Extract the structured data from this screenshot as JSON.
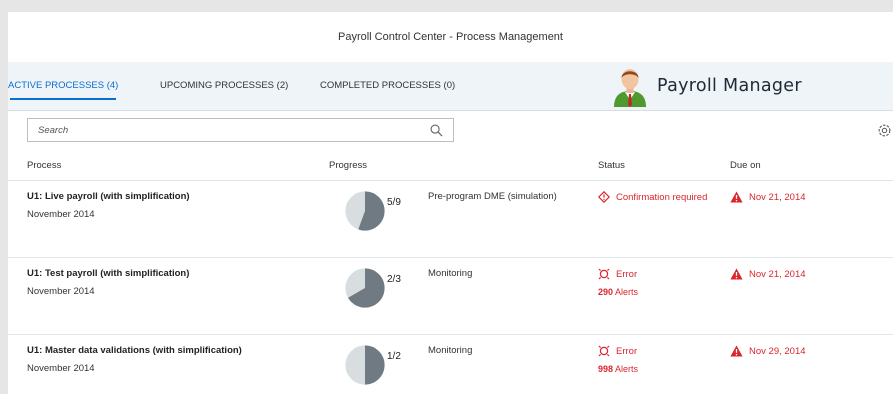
{
  "header": {
    "title": "Payroll Control Center - Process Management"
  },
  "tabs": [
    {
      "label": "ACTIVE PROCESSES (4)"
    },
    {
      "label": "UPCOMING PROCESSES (2)"
    },
    {
      "label": "COMPLETED PROCESSES (0)"
    }
  ],
  "user": {
    "name": "Payroll Manager",
    "icon": "user-avatar-icon"
  },
  "search": {
    "placeholder": "Search"
  },
  "columns": {
    "process": "Process",
    "progress": "Progress",
    "status": "Status",
    "due": "Due on"
  },
  "colors": {
    "accent": "#0a6ed1",
    "error": "#d9262c",
    "pie_fill": "#6f7a83",
    "pie_bg": "#d8dde0"
  },
  "rows": [
    {
      "name": "U1: Live payroll (with simplification)",
      "period": "November 2014",
      "progress": "5/9",
      "progress_fraction": 0.5556,
      "step": "Pre-program DME (simulation)",
      "status": "Confirmation required",
      "status_icon": "warning-diamond-icon",
      "alerts_count": "",
      "alerts_label": "",
      "due": "Nov 21, 2014"
    },
    {
      "name": "U1: Test payroll (with simplification)",
      "period": "November 2014",
      "progress": "2/3",
      "progress_fraction": 0.6667,
      "step": "Monitoring",
      "status": "Error",
      "status_icon": "error-icon",
      "alerts_count": "290",
      "alerts_label": "Alerts",
      "due": "Nov 21, 2014"
    },
    {
      "name": "U1: Master data validations (with simplification)",
      "period": "November 2014",
      "progress": "1/2",
      "progress_fraction": 0.5,
      "step": "Monitoring",
      "status": "Error",
      "status_icon": "error-icon",
      "alerts_count": "998",
      "alerts_label": "Alerts",
      "due": "Nov 29, 2014"
    }
  ]
}
